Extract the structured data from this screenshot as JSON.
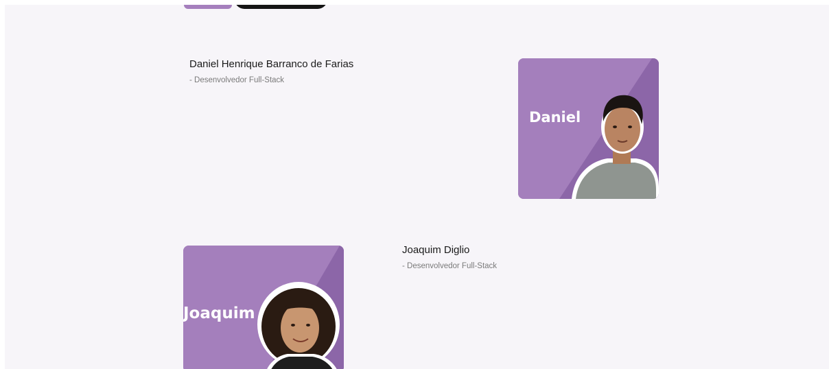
{
  "members": [
    {
      "name": "Daniel Henrique Barranco de Farias",
      "role": "- Desenvolvedor Full-Stack",
      "card_label": "Daniel"
    },
    {
      "name": "Joaquim Diglio",
      "role": "- Desenvolvedor Full-Stack",
      "card_label": "Joaquim"
    }
  ],
  "colors": {
    "page_background": "#f7f5f9",
    "card_purple": "#a47fbc",
    "card_purple_dark": "#8c66a8"
  }
}
